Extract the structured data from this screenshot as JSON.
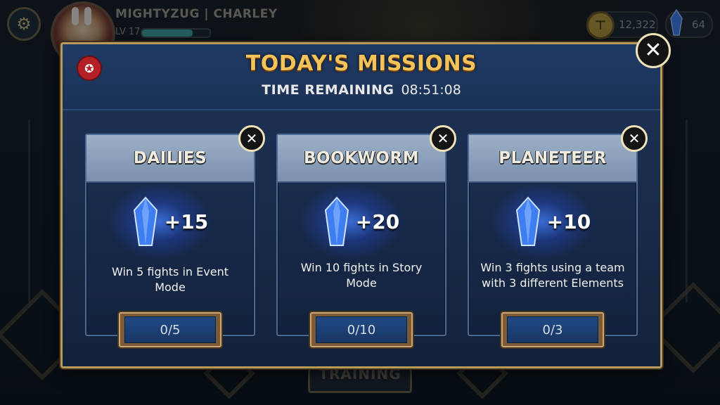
{
  "hud": {
    "player_name": "MIGHTYZUG | CHARLEY",
    "level": "LV 17",
    "xp_fraction": 0.75,
    "coins": "12,322",
    "gems": "64",
    "bottom_tab": "TRAINING"
  },
  "modal": {
    "title": "TODAY'S MISSIONS",
    "timer_label": "TIME REMAINING",
    "timer_value": "08:51:08",
    "close_icon": "close-icon",
    "badge_icon": "mission-badge-icon"
  },
  "missions": [
    {
      "title": "DAILIES",
      "reward": "+15",
      "description": "Win 5 fights in Event Mode",
      "progress": "0/5"
    },
    {
      "title": "BOOKWORM",
      "reward": "+20",
      "description": "Win 10 fights in Story Mode",
      "progress": "0/10"
    },
    {
      "title": "PLANETEER",
      "reward": "+10",
      "description": "Win 3 fights using a team with 3 different Elements",
      "progress": "0/3"
    }
  ],
  "colors": {
    "title_gold": "#f2c35a",
    "modal_border": "#b89a5a",
    "gem_blue": "#3f7ef0",
    "badge_red": "#b32025"
  }
}
